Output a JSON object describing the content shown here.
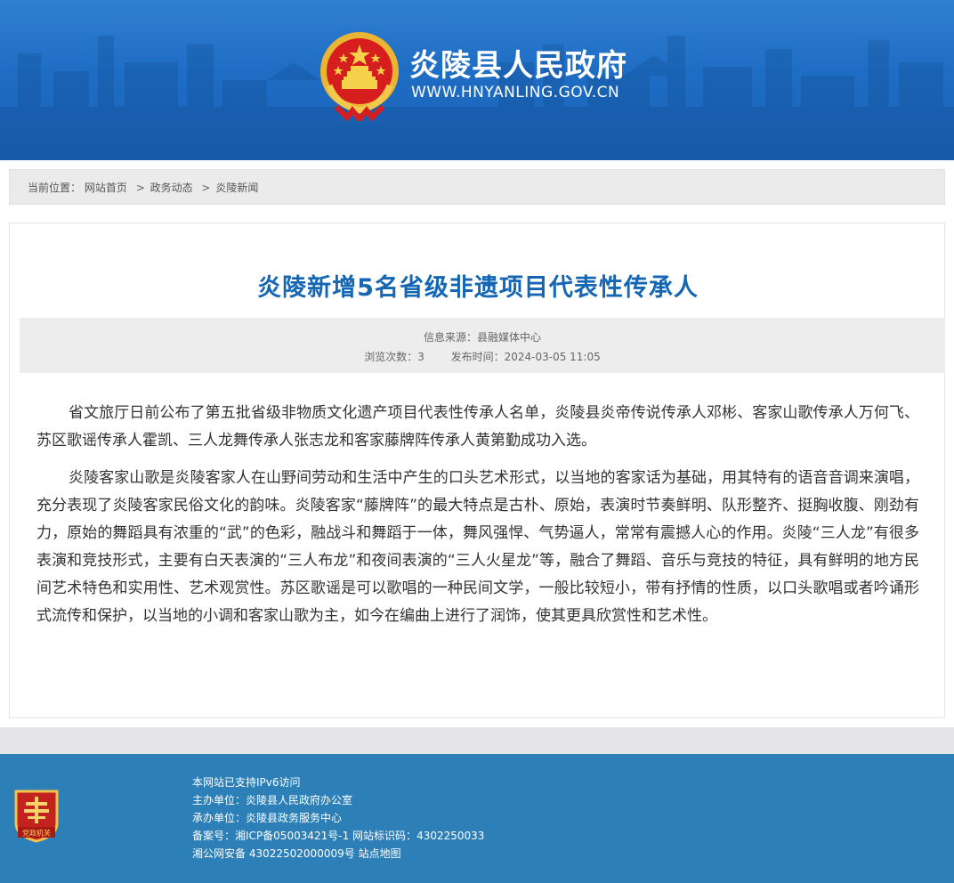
{
  "header": {
    "site_title": "炎陵县人民政府",
    "site_url": "WWW.HNYANLING.GOV.CN",
    "emblem_icon": "national-emblem-icon",
    "bg_color": "#1e6dc4"
  },
  "breadcrumb": {
    "prefix": "当前位置：",
    "items": [
      "网站首页",
      "政务动态",
      "炎陵新闻"
    ],
    "separator": ">"
  },
  "article": {
    "title": "炎陵新增5名省级非遗项目代表性传承人",
    "title_color": "#1567b3",
    "source_label": "信息来源：",
    "source": "县融媒体中心",
    "views_label": "浏览次数：",
    "views": "3",
    "date_label": "发布时间：",
    "date": "2024-03-05 11:05",
    "paragraphs": [
      "省文旅厅日前公布了第五批省级非物质文化遗产项目代表性传承人名单，炎陵县炎帝传说传承人邓彬、客家山歌传承人万何飞、苏区歌谣传承人霍凯、三人龙舞传承人张志龙和客家藤牌阵传承人黄第勤成功入选。",
      "炎陵客家山歌是炎陵客家人在山野间劳动和生活中产生的口头艺术形式，以当地的客家话为基础，用其特有的语音音调来演唱，充分表现了炎陵客家民俗文化的韵味。炎陵客家“藤牌阵”的最大特点是古朴、原始，表演时节奏鲜明、队形整齐、挺胸收腹、刚劲有力，原始的舞蹈具有浓重的“武”的色彩，融战斗和舞蹈于一体，舞风强悍、气势逼人，常常有震撼人心的作用。炎陵“三人龙”有很多表演和竞技形式，主要有白天表演的“三人布龙”和夜间表演的“三人火星龙”等，融合了舞蹈、音乐与竞技的特征，具有鲜明的地方民间艺术特色和实用性、艺术观赏性。苏区歌谣是可以歌唱的一种民间文学，一般比较短小，带有抒情的性质，以口头歌唱或者吟诵形式流传和保护，以当地的小调和客家山歌为主，如今在编曲上进行了润饰，使其更具欣赏性和艺术性。"
    ]
  },
  "footer": {
    "badge_text": "党政机关",
    "badge_icon": "party-government-badge-icon",
    "bg_color": "#2d7fb8",
    "ipv6": "本网站已支持IPv6访问",
    "host_label": "主办单位：",
    "host": "炎陵县人民政府办公室",
    "organizer_label": "承办单位：",
    "organizer": "炎陵县政务服务中心",
    "icp_label": "备案号：",
    "icp": "湘ICP备05003421号-1",
    "site_id_label": "网站标识码：",
    "site_id": "4302250033",
    "police_label": "湘公网安备",
    "police_no": "43022502000009号",
    "sitemap": "站点地图"
  }
}
